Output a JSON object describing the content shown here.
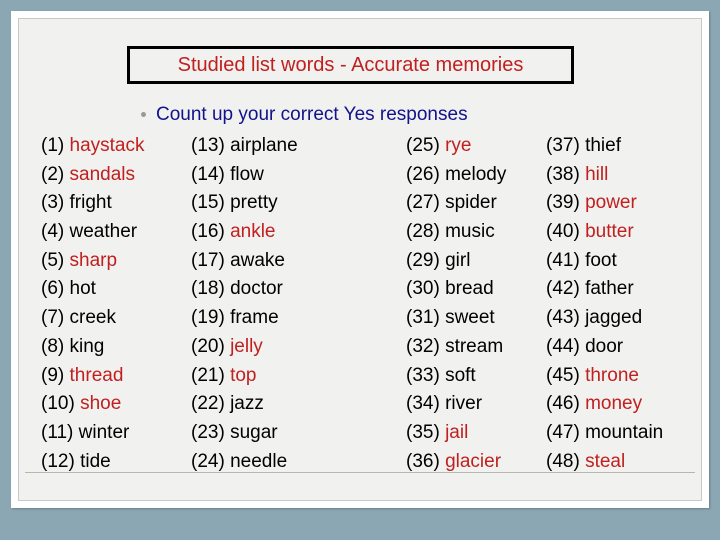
{
  "slide": {
    "title": "Studied list words - Accurate memories",
    "bullet": "Count up your correct Yes responses",
    "colors": {
      "title_text": "#c0201f",
      "bullet_text": "#12128c",
      "word_black": "#000000",
      "word_red": "#c0201f",
      "title_border": "#000000",
      "slide_background": "#f1f1ef",
      "outer_background": "#8ba7b4"
    },
    "columns": [
      {
        "items": [
          {
            "number": "(1)",
            "word": "haystack",
            "color": "red"
          },
          {
            "number": "(2)",
            "word": "sandals",
            "color": "red"
          },
          {
            "number": "(3)",
            "word": "fright",
            "color": "black"
          },
          {
            "number": "(4)",
            "word": "weather",
            "color": "black"
          },
          {
            "number": "(5)",
            "word": "sharp",
            "color": "red"
          },
          {
            "number": "(6)",
            "word": "hot",
            "color": "black"
          },
          {
            "number": "(7)",
            "word": "creek",
            "color": "black"
          },
          {
            "number": "(8)",
            "word": "king",
            "color": "black"
          },
          {
            "number": "(9)",
            "word": "thread",
            "color": "red"
          },
          {
            "number": "(10)",
            "word": "shoe",
            "color": "red"
          },
          {
            "number": "(11)",
            "word": "winter",
            "color": "black"
          },
          {
            "number": "(12)",
            "word": "tide",
            "color": "black"
          }
        ]
      },
      {
        "items": [
          {
            "number": "(13)",
            "word": "airplane",
            "color": "black"
          },
          {
            "number": "(14)",
            "word": "flow",
            "color": "black"
          },
          {
            "number": "(15)",
            "word": "pretty",
            "color": "black"
          },
          {
            "number": "(16)",
            "word": "ankle",
            "color": "red"
          },
          {
            "number": "(17)",
            "word": "awake",
            "color": "black"
          },
          {
            "number": "(18)",
            "word": "doctor",
            "color": "black"
          },
          {
            "number": "(19)",
            "word": "frame",
            "color": "black"
          },
          {
            "number": "(20)",
            "word": "jelly",
            "color": "red"
          },
          {
            "number": "(21)",
            "word": "top",
            "color": "red"
          },
          {
            "number": "(22)",
            "word": "jazz",
            "color": "black"
          },
          {
            "number": "(23)",
            "word": "sugar",
            "color": "black"
          },
          {
            "number": "(24)",
            "word": "needle",
            "color": "black"
          }
        ]
      },
      {
        "items": [
          {
            "number": "(25)",
            "word": "rye",
            "color": "red"
          },
          {
            "number": "(26)",
            "word": "melody",
            "color": "black"
          },
          {
            "number": "(27)",
            "word": "spider",
            "color": "black"
          },
          {
            "number": "(28)",
            "word": "music",
            "color": "black"
          },
          {
            "number": "(29)",
            "word": "girl",
            "color": "black"
          },
          {
            "number": "(30)",
            "word": "bread",
            "color": "black"
          },
          {
            "number": "(31)",
            "word": "sweet",
            "color": "black"
          },
          {
            "number": "(32)",
            "word": "stream",
            "color": "black"
          },
          {
            "number": "(33)",
            "word": "soft",
            "color": "black"
          },
          {
            "number": "(34)",
            "word": "river",
            "color": "black"
          },
          {
            "number": "(35)",
            "word": "jail",
            "color": "red"
          },
          {
            "number": "(36)",
            "word": "glacier",
            "color": "red"
          }
        ]
      },
      {
        "items": [
          {
            "number": "(37)",
            "word": "thief",
            "color": "black"
          },
          {
            "number": "(38)",
            "word": "hill",
            "color": "red"
          },
          {
            "number": "(39)",
            "word": "power",
            "color": "red"
          },
          {
            "number": "(40)",
            "word": "butter",
            "color": "red"
          },
          {
            "number": "(41)",
            "word": "foot",
            "color": "black"
          },
          {
            "number": "(42)",
            "word": "father",
            "color": "black"
          },
          {
            "number": "(43)",
            "word": "jagged",
            "color": "black"
          },
          {
            "number": "(44)",
            "word": "door",
            "color": "black"
          },
          {
            "number": "(45)",
            "word": "throne",
            "color": "red"
          },
          {
            "number": "(46)",
            "word": "money",
            "color": "red"
          },
          {
            "number": "(47)",
            "word": "mountain",
            "color": "black"
          },
          {
            "number": "(48)",
            "word": "steal",
            "color": "red"
          }
        ]
      }
    ]
  }
}
